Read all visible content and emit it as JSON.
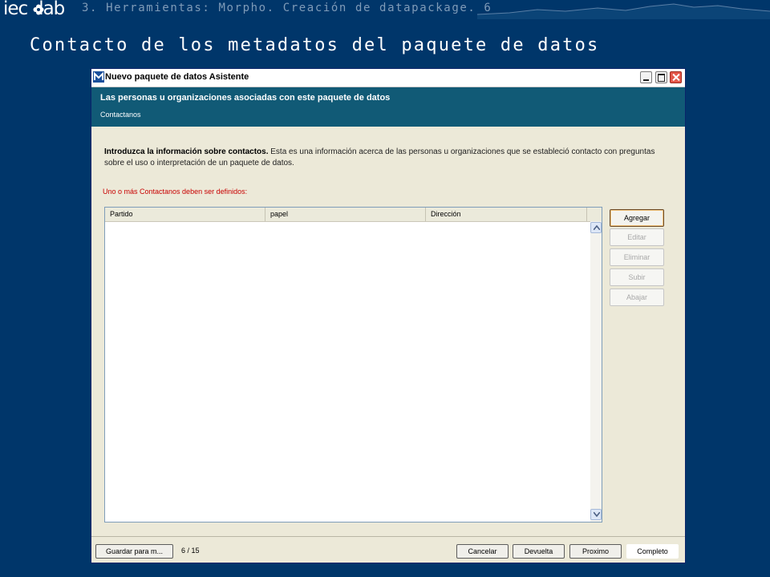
{
  "slide": {
    "logo_text": "iec",
    "logo_tail": "lab",
    "breadcrumb": "3. Herramientas: Morpho. Creación de datapackage. 6",
    "title": "Contacto de los metadatos del paquete de datos"
  },
  "window": {
    "title": "Nuevo paquete de datos Asistente",
    "banner_title": "Las personas u organizaciones asociadas con este paquete de datos",
    "banner_subtitle": "Contactanos"
  },
  "content": {
    "intro_bold": "Introduzca la información sobre contactos.",
    "intro_text": " Esta es una información acerca de las personas u organizaciones que se estableció contacto con preguntas sobre el uso o interpretación de un paquete de datos.",
    "warning": "Uno o más Contactanos deben ser definidos:"
  },
  "table": {
    "columns": [
      "Partido",
      "papel",
      "Dirección"
    ],
    "rows": []
  },
  "side_buttons": {
    "agregar": "Agregar",
    "editar": "Editar",
    "eliminar": "Eliminar",
    "subir": "Subir",
    "abajar": "Abajar"
  },
  "footer": {
    "guardar": "Guardar para m...",
    "page": "6 / 15",
    "cancelar": "Cancelar",
    "devuelta": "Devuelta",
    "proximo": "Proximo",
    "completo": "Completo"
  },
  "colors": {
    "slide_background": "#00366a",
    "banner": "#115a76",
    "warning": "#c80000"
  },
  "icons": {
    "app": "metadata-app-icon",
    "scroll_up": "arrow-up-icon",
    "scroll_down": "arrow-down-icon"
  }
}
